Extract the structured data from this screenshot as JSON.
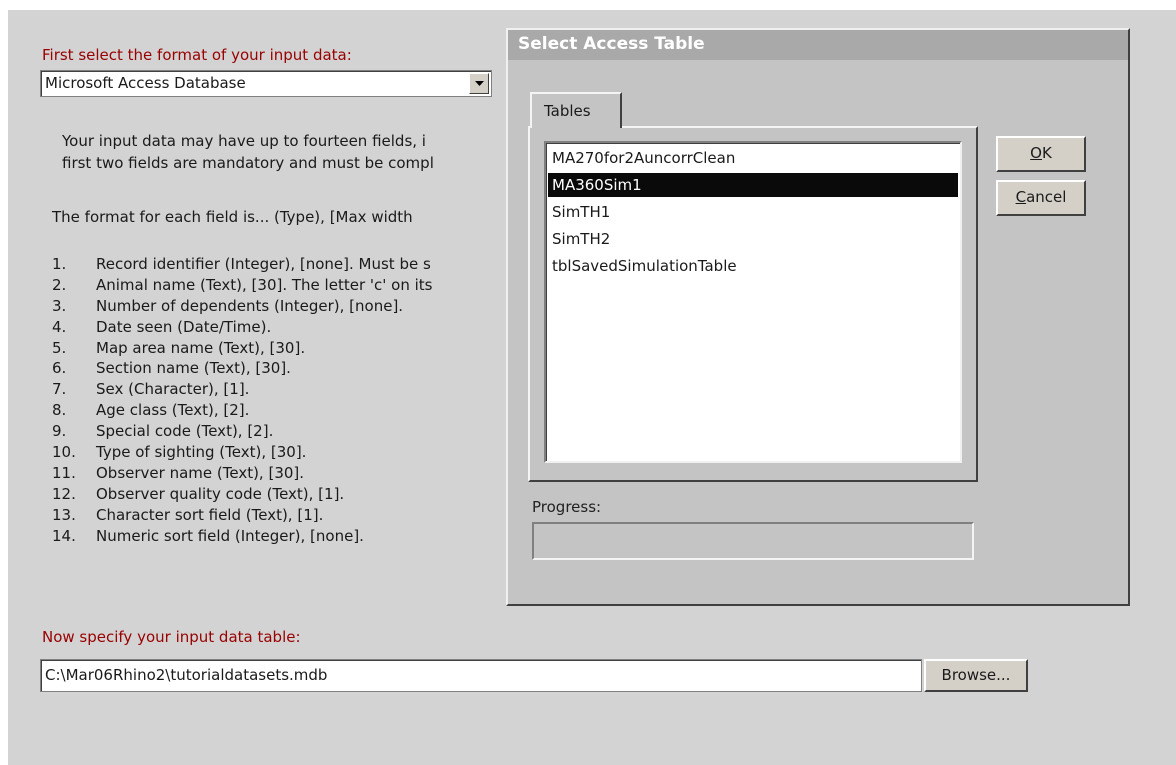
{
  "main": {
    "format_prompt": "First select the format of your input data:",
    "format_value": "Microsoft Access Database",
    "desc_line1": "Your input data may have up to fourteen fields, i",
    "desc_line2": "first two fields are mandatory and must be compl",
    "desc_format": "The format for each field is... (Type), [Max width",
    "fields": [
      {
        "num": "1.",
        "text": "Record identifier (Integer), [none]. Must be s"
      },
      {
        "num": "2.",
        "text": "Animal name (Text), [30].  The letter 'c' on its"
      },
      {
        "num": "3.",
        "text": "Number of dependents (Integer), [none]."
      },
      {
        "num": "4.",
        "text": "Date seen (Date/Time)."
      },
      {
        "num": "5.",
        "text": "Map area name (Text), [30]."
      },
      {
        "num": "6.",
        "text": "Section name (Text), [30]."
      },
      {
        "num": "7.",
        "text": "Sex (Character), [1]."
      },
      {
        "num": "8.",
        "text": "Age class (Text), [2]."
      },
      {
        "num": "9.",
        "text": "Special code (Text), [2]."
      },
      {
        "num": "10.",
        "text": "Type of sighting (Text), [30]."
      },
      {
        "num": "11.",
        "text": "Observer name (Text), [30]."
      },
      {
        "num": "12.",
        "text": "Observer quality code (Text), [1]."
      },
      {
        "num": "13.",
        "text": "Character sort field (Text), [1]."
      },
      {
        "num": "14.",
        "text": "Numeric sort field (Integer), [none]."
      }
    ],
    "table_prompt": "Now specify your input data table:",
    "path_value": "C:\\Mar06Rhino2\\tutorialdatasets.mdb",
    "browse_label": "Browse..."
  },
  "dialog": {
    "title": "Select Access Table",
    "tab_label": "Tables",
    "tables": [
      "MA270for2AuncorrClean",
      "MA360Sim1",
      "SimTH1",
      "SimTH2",
      "tblSavedSimulationTable"
    ],
    "selected_index": 1,
    "ok_label": "OK",
    "cancel_label": "Cancel",
    "progress_label": "Progress:",
    "progress_value": 0
  },
  "colors": {
    "accent_red": "#990000",
    "selection": "#0a0a0a"
  }
}
